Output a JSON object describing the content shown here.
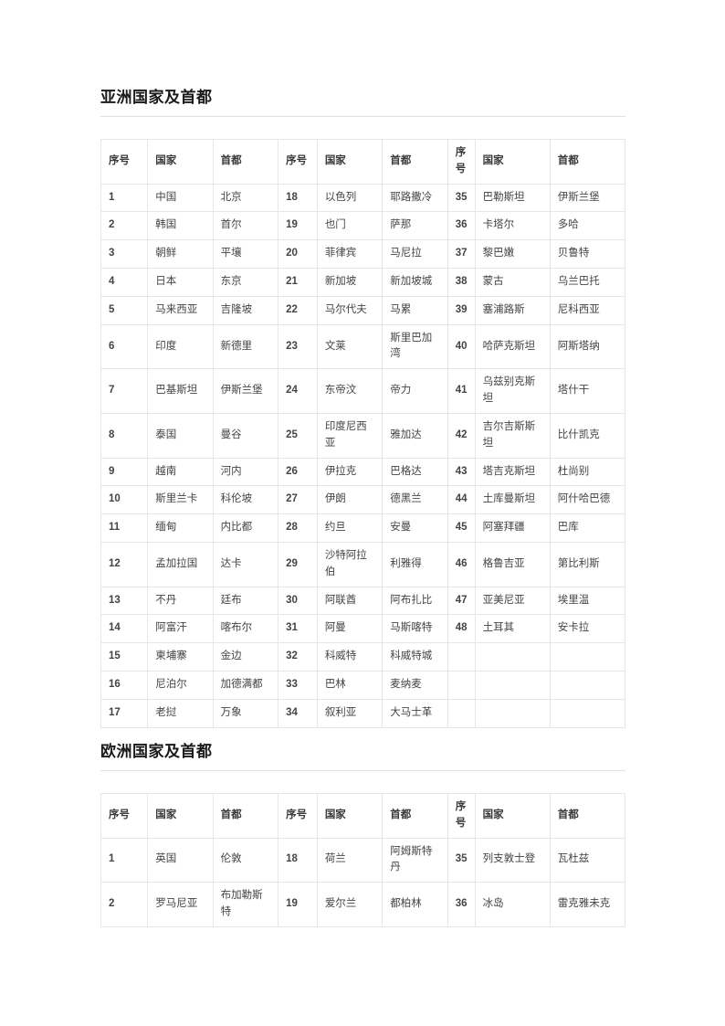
{
  "sections": [
    {
      "id": "asia",
      "heading": "亚洲国家及首都",
      "headers": [
        "序号",
        "国家",
        "首都",
        "序号",
        "国家",
        "首都",
        "序号",
        "国家",
        "首都"
      ],
      "rows": [
        [
          {
            "t": "1",
            "k": "num"
          },
          {
            "t": "中国",
            "k": "link"
          },
          {
            "t": "北京",
            "k": "link"
          },
          {
            "t": "18",
            "k": "num"
          },
          {
            "t": "以色列",
            "k": "link"
          },
          {
            "t": "耶路撒冷",
            "k": "link"
          },
          {
            "t": "35",
            "k": "num"
          },
          {
            "t": "巴勒斯坦",
            "k": "link"
          },
          {
            "t": "伊斯兰堡",
            "k": "plain"
          }
        ],
        [
          {
            "t": "2",
            "k": "num"
          },
          {
            "t": "韩国",
            "k": "link"
          },
          {
            "t": "首尔",
            "k": "link"
          },
          {
            "t": "19",
            "k": "num"
          },
          {
            "t": "也门",
            "k": "link"
          },
          {
            "t": "萨那",
            "k": "link"
          },
          {
            "t": "36",
            "k": "num"
          },
          {
            "t": "卡塔尔",
            "k": "link"
          },
          {
            "t": "多哈",
            "k": "link"
          }
        ],
        [
          {
            "t": "3",
            "k": "num"
          },
          {
            "t": "朝鲜",
            "k": "link"
          },
          {
            "t": "平壤",
            "k": "link"
          },
          {
            "t": "20",
            "k": "num"
          },
          {
            "t": "菲律宾",
            "k": "link"
          },
          {
            "t": "马尼拉",
            "k": "link"
          },
          {
            "t": "37",
            "k": "num"
          },
          {
            "t": "黎巴嫩",
            "k": "link"
          },
          {
            "t": "贝鲁特",
            "k": "link"
          }
        ],
        [
          {
            "t": "4",
            "k": "num"
          },
          {
            "t": "日本",
            "k": "link"
          },
          {
            "t": "东京",
            "k": "link"
          },
          {
            "t": "21",
            "k": "num"
          },
          {
            "t": "新加坡",
            "k": "link"
          },
          {
            "t": "新加坡城",
            "k": "link"
          },
          {
            "t": "38",
            "k": "num"
          },
          {
            "t": "蒙古",
            "k": "link"
          },
          {
            "t": "乌兰巴托",
            "k": "link"
          }
        ],
        [
          {
            "t": "5",
            "k": "num"
          },
          {
            "t": "马来西亚",
            "k": "link"
          },
          {
            "t": "吉隆坡",
            "k": "link"
          },
          {
            "t": "22",
            "k": "num"
          },
          {
            "t": "马尔代夫",
            "k": "link"
          },
          {
            "t": "马累",
            "k": "link"
          },
          {
            "t": "39",
            "k": "num"
          },
          {
            "t": "塞浦路斯",
            "k": "link"
          },
          {
            "t": "尼科西亚",
            "k": "link"
          }
        ],
        [
          {
            "t": "6",
            "k": "num"
          },
          {
            "t": "印度",
            "k": "link"
          },
          {
            "t": "新德里",
            "k": "link"
          },
          {
            "t": "23",
            "k": "num"
          },
          {
            "t": "文莱",
            "k": "link"
          },
          {
            "t": "斯里巴加湾",
            "k": "link"
          },
          {
            "t": "40",
            "k": "num"
          },
          {
            "t": "哈萨克斯坦",
            "k": "link"
          },
          {
            "t": "阿斯塔纳",
            "k": "link"
          }
        ],
        [
          {
            "t": "7",
            "k": "num"
          },
          {
            "t": "巴基斯坦",
            "k": "link"
          },
          {
            "t": "伊斯兰堡",
            "k": "link"
          },
          {
            "t": "24",
            "k": "num"
          },
          {
            "t": "东帝汶",
            "k": "link"
          },
          {
            "t": "帝力",
            "k": "link"
          },
          {
            "t": "41",
            "k": "num"
          },
          {
            "t": "乌兹别克斯坦",
            "k": "link"
          },
          {
            "t": "塔什干",
            "k": "link"
          }
        ],
        [
          {
            "t": "8",
            "k": "num"
          },
          {
            "t": "泰国",
            "k": "link"
          },
          {
            "t": "曼谷",
            "k": "link"
          },
          {
            "t": "25",
            "k": "num"
          },
          {
            "t": "印度尼西亚",
            "k": "link"
          },
          {
            "t": "雅加达",
            "k": "link"
          },
          {
            "t": "42",
            "k": "num"
          },
          {
            "t": "吉尔吉斯斯坦",
            "k": "link"
          },
          {
            "t": "比什凯克",
            "k": "link"
          }
        ],
        [
          {
            "t": "9",
            "k": "num"
          },
          {
            "t": "越南",
            "k": "link"
          },
          {
            "t": "河内",
            "k": "link"
          },
          {
            "t": "26",
            "k": "num"
          },
          {
            "t": "伊拉克",
            "k": "link"
          },
          {
            "t": "巴格达",
            "k": "link"
          },
          {
            "t": "43",
            "k": "num"
          },
          {
            "t": "塔吉克斯坦",
            "k": "link"
          },
          {
            "t": "杜尚别",
            "k": "link"
          }
        ],
        [
          {
            "t": "10",
            "k": "num"
          },
          {
            "t": "斯里兰卡",
            "k": "link"
          },
          {
            "t": "科伦坡",
            "k": "link"
          },
          {
            "t": "27",
            "k": "num"
          },
          {
            "t": "伊朗",
            "k": "link"
          },
          {
            "t": "德黑兰",
            "k": "link"
          },
          {
            "t": "44",
            "k": "num"
          },
          {
            "t": "土库曼斯坦",
            "k": "link"
          },
          {
            "t": "阿什哈巴德",
            "k": "link"
          }
        ],
        [
          {
            "t": "11",
            "k": "num"
          },
          {
            "t": "缅甸",
            "k": "link"
          },
          {
            "t": "内比都",
            "k": "link"
          },
          {
            "t": "28",
            "k": "num"
          },
          {
            "t": "约旦",
            "k": "link"
          },
          {
            "t": "安曼",
            "k": "link"
          },
          {
            "t": "45",
            "k": "num"
          },
          {
            "t": "阿塞拜疆",
            "k": "link"
          },
          {
            "t": "巴库",
            "k": "link"
          }
        ],
        [
          {
            "t": "12",
            "k": "num"
          },
          {
            "t": "孟加拉国",
            "k": "link"
          },
          {
            "t": "达卡",
            "k": "link"
          },
          {
            "t": "29",
            "k": "num"
          },
          {
            "t": "沙特阿拉伯",
            "k": "link"
          },
          {
            "t": "利雅得",
            "k": "link"
          },
          {
            "t": "46",
            "k": "num"
          },
          {
            "t": "格鲁吉亚",
            "k": "link"
          },
          {
            "t": "第比利斯",
            "k": "link"
          }
        ],
        [
          {
            "t": "13",
            "k": "num"
          },
          {
            "t": "不丹",
            "k": "link"
          },
          {
            "t": "廷布",
            "k": "link"
          },
          {
            "t": "30",
            "k": "num"
          },
          {
            "t": "阿联酋",
            "k": "link"
          },
          {
            "t": "阿布扎比",
            "k": "link"
          },
          {
            "t": "47",
            "k": "num"
          },
          {
            "t": "亚美尼亚",
            "k": "link"
          },
          {
            "t": "埃里温",
            "k": "link"
          }
        ],
        [
          {
            "t": "14",
            "k": "num"
          },
          {
            "t": "阿富汗",
            "k": "link"
          },
          {
            "t": "喀布尔",
            "k": "link"
          },
          {
            "t": "31",
            "k": "num"
          },
          {
            "t": "阿曼",
            "k": "link"
          },
          {
            "t": "马斯喀特",
            "k": "link"
          },
          {
            "t": "48",
            "k": "num"
          },
          {
            "t": "土耳其",
            "k": "link"
          },
          {
            "t": "安卡拉",
            "k": "link"
          }
        ],
        [
          {
            "t": "15",
            "k": "num"
          },
          {
            "t": "柬埔寨",
            "k": "link"
          },
          {
            "t": "金边",
            "k": "link"
          },
          {
            "t": "32",
            "k": "num"
          },
          {
            "t": "科威特",
            "k": "link"
          },
          {
            "t": "科威特城",
            "k": "link"
          },
          {
            "t": "",
            "k": "empty"
          },
          {
            "t": "",
            "k": "empty"
          },
          {
            "t": "",
            "k": "empty"
          }
        ],
        [
          {
            "t": "16",
            "k": "num"
          },
          {
            "t": "尼泊尔",
            "k": "link"
          },
          {
            "t": "加德满都",
            "k": "link"
          },
          {
            "t": "33",
            "k": "num"
          },
          {
            "t": "巴林",
            "k": "link"
          },
          {
            "t": "麦纳麦",
            "k": "link"
          },
          {
            "t": "",
            "k": "empty"
          },
          {
            "t": "",
            "k": "empty"
          },
          {
            "t": "",
            "k": "empty"
          }
        ],
        [
          {
            "t": "17",
            "k": "num"
          },
          {
            "t": "老挝",
            "k": "link"
          },
          {
            "t": "万象",
            "k": "link"
          },
          {
            "t": "34",
            "k": "num"
          },
          {
            "t": "叙利亚",
            "k": "link"
          },
          {
            "t": "大马士革",
            "k": "link"
          },
          {
            "t": "",
            "k": "empty"
          },
          {
            "t": "",
            "k": "empty"
          },
          {
            "t": "",
            "k": "empty"
          }
        ]
      ]
    },
    {
      "id": "europe",
      "heading": "欧洲国家及首都",
      "headers": [
        "序号",
        "国家",
        "首都",
        "序号",
        "国家",
        "首都",
        "序号",
        "国家",
        "首都"
      ],
      "rows": [
        [
          {
            "t": "1",
            "k": "num"
          },
          {
            "t": "英国",
            "k": "link"
          },
          {
            "t": "伦敦",
            "k": "link"
          },
          {
            "t": "18",
            "k": "num"
          },
          {
            "t": "荷兰",
            "k": "link"
          },
          {
            "t": "阿姆斯特丹",
            "k": "link"
          },
          {
            "t": "35",
            "k": "num"
          },
          {
            "t": "列支敦士登",
            "k": "link"
          },
          {
            "t": "瓦杜兹",
            "k": "link"
          }
        ],
        [
          {
            "t": "2",
            "k": "num"
          },
          {
            "t": "罗马尼亚",
            "k": "link"
          },
          {
            "t": "布加勒斯特",
            "k": "link"
          },
          {
            "t": "19",
            "k": "num"
          },
          {
            "t": "爱尔兰",
            "k": "link"
          },
          {
            "t": "都柏林",
            "k": "link"
          },
          {
            "t": "36",
            "k": "num"
          },
          {
            "t": "冰岛",
            "k": "link"
          },
          {
            "t": "雷克雅未克",
            "k": "link"
          }
        ]
      ]
    }
  ],
  "colors": {
    "link": "#1769b0",
    "heading": "#1a1a1a",
    "border": "#e6e6e6",
    "plain_text": "#4a4a4a"
  }
}
